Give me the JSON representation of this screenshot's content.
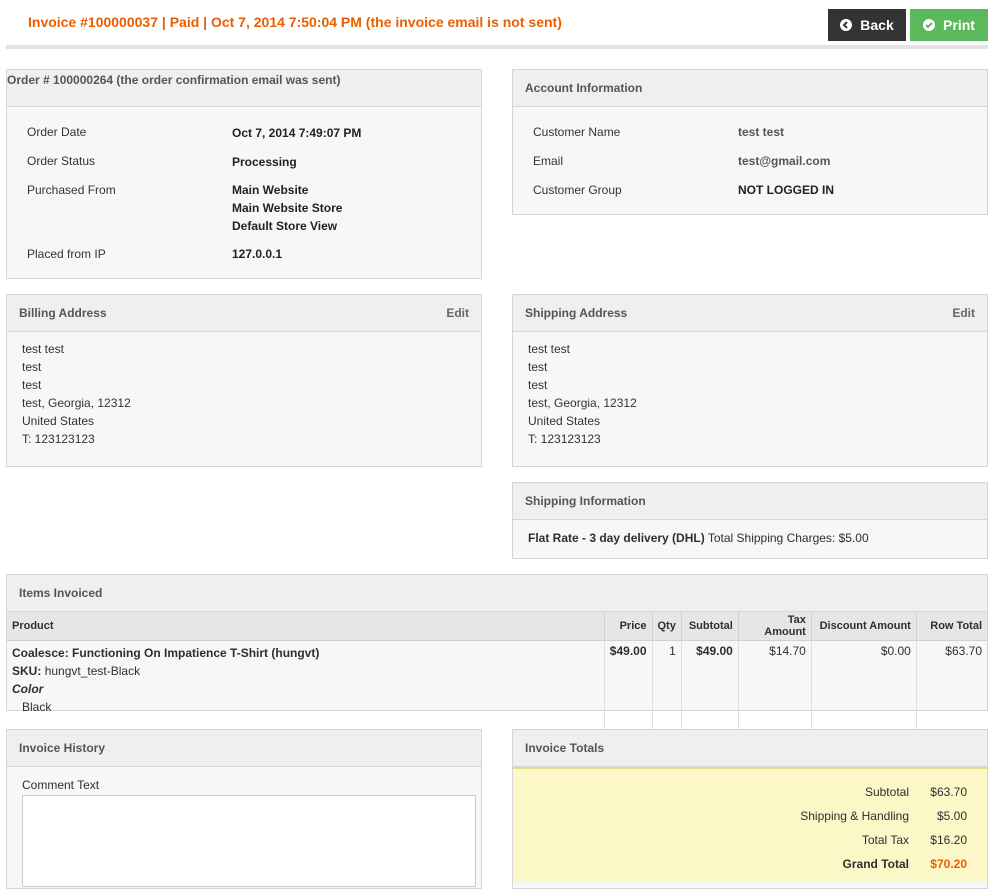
{
  "header": {
    "title": "Invoice #100000037 | Paid | Oct 7, 2014 7:50:04 PM (the invoice email is not sent)",
    "back_label": "Back",
    "print_label": "Print"
  },
  "order": {
    "title": "Order # 100000264 (the order confirmation email was sent)",
    "date_label": "Order Date",
    "date_value": "Oct 7, 2014 7:49:07 PM",
    "status_label": "Order Status",
    "status_value": "Processing",
    "purchased_label": "Purchased From",
    "purchased_lines": [
      "Main Website",
      "Main Website Store",
      "Default Store View"
    ],
    "ip_label": "Placed from IP",
    "ip_value": "127.0.0.1"
  },
  "account": {
    "title": "Account Information",
    "name_label": "Customer Name",
    "name_value": "test test",
    "email_label": "Email",
    "email_value": "test@gmail.com",
    "group_label": "Customer Group",
    "group_value": "NOT LOGGED IN"
  },
  "billing": {
    "title": "Billing Address",
    "edit_label": "Edit",
    "lines": [
      "test test",
      "test",
      "test",
      "test, Georgia, 12312",
      "United States",
      "T: 123123123"
    ]
  },
  "shipping": {
    "title": "Shipping Address",
    "edit_label": "Edit",
    "lines": [
      "test test",
      "test",
      "test",
      "test, Georgia, 12312",
      "United States",
      "T: 123123123"
    ]
  },
  "shipping_info": {
    "title": "Shipping Information",
    "method": "Flat Rate - 3 day delivery (DHL)",
    "charges": "Total Shipping Charges: $5.00"
  },
  "items": {
    "title": "Items Invoiced",
    "columns": [
      "Product",
      "Price",
      "Qty",
      "Subtotal",
      "Tax Amount",
      "Discount Amount",
      "Row Total"
    ],
    "row": {
      "name": "Coalesce: Functioning On Impatience T-Shirt (hungvt)",
      "sku_label": "SKU:",
      "sku_value": "hungvt_test-Black",
      "option_label": "Color",
      "option_value": "Black",
      "price": "$49.00",
      "qty": "1",
      "subtotal": "$49.00",
      "tax": "$14.70",
      "discount": "$0.00",
      "row_total": "$63.70"
    }
  },
  "history": {
    "title": "Invoice History",
    "comment_label": "Comment Text"
  },
  "totals": {
    "title": "Invoice Totals",
    "subtotal_label": "Subtotal",
    "subtotal_value": "$63.70",
    "shipping_label": "Shipping & Handling",
    "shipping_value": "$5.00",
    "tax_label": "Total Tax",
    "tax_value": "$16.20",
    "grand_label": "Grand Total",
    "grand_value": "$70.20"
  }
}
